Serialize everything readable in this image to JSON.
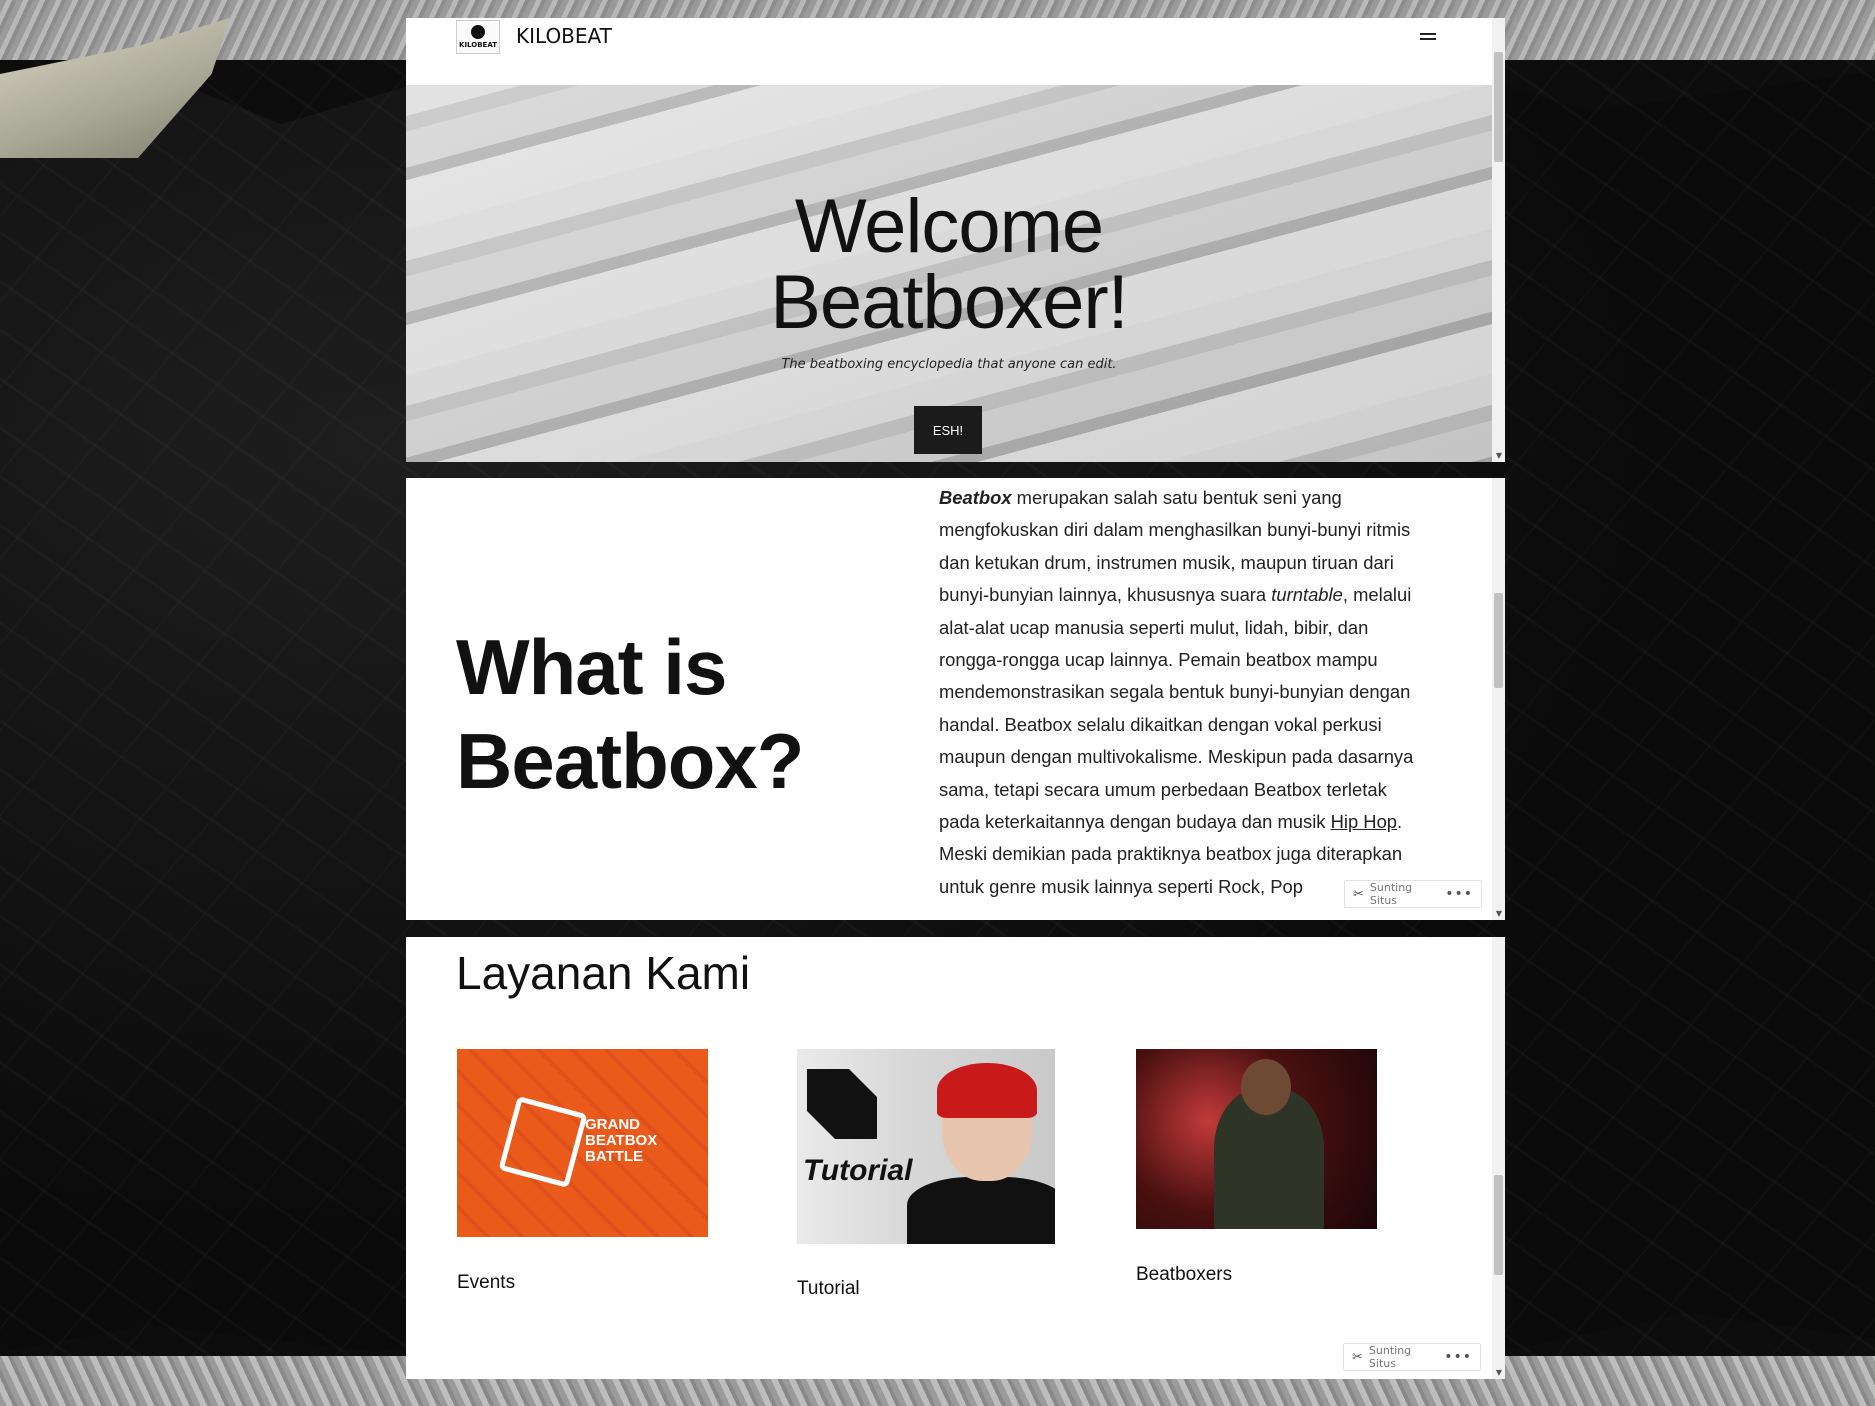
{
  "site": {
    "title": "KILOBEAT",
    "logo_text": "KILOBEAT"
  },
  "hero": {
    "title_line1": "Welcome",
    "title_line2": "Beatboxer!",
    "subtitle": "The beatboxing encyclopedia that anyone can edit.",
    "button_label": "ESH!"
  },
  "about": {
    "heading_line1": "What is",
    "heading_line2": "Beatbox?",
    "term": "Beatbox",
    "text_a": " merupakan salah satu bentuk seni yang mengfokuskan diri dalam menghasilkan bunyi-bunyi ritmis dan ketukan drum, instrumen musik, maupun tiruan dari bunyi-bunyian lainnya, khususnya suara ",
    "term2": "turntable",
    "text_b": ", melalui alat-alat ucap manusia seperti mulut, lidah, bibir, dan rongga-rongga ucap lainnya. Pemain beatbox mampu mendemonstrasikan segala bentuk bunyi-bunyian dengan handal. Beatbox selalu dikaitkan dengan vokal perkusi maupun dengan multivokalisme. Meskipun pada dasarnya sama, tetapi secara umum perbedaan Beatbox terletak pada keterkaitannya dengan budaya dan musik ",
    "link": "Hip Hop",
    "text_c": ". Meski demikian pada praktiknya beatbox juga diterapkan untuk genre musik lainnya seperti Rock, Pop"
  },
  "edit_chip": {
    "label": "Sunting Situs",
    "more": "•••"
  },
  "services": {
    "title": "Layanan Kami",
    "cards": [
      {
        "label": "Events",
        "image_text": "GRAND BEATBOX BATTLE"
      },
      {
        "label": "Tutorial",
        "image_text": "Tutorial"
      },
      {
        "label": "Beatboxers"
      }
    ]
  },
  "colors": {
    "accent_orange": "#e8541a",
    "button_dark": "#1b1b1b"
  }
}
